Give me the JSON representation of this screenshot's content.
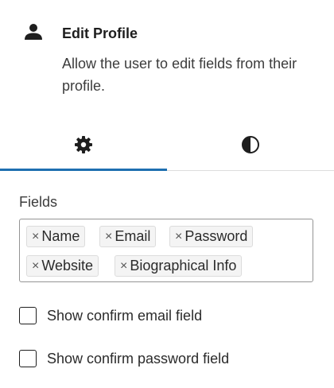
{
  "block": {
    "icon": "user-icon",
    "title": "Edit Profile",
    "description": "Allow the user to edit fields from their profile."
  },
  "tabs": [
    {
      "icon": "gear-icon",
      "active": true
    },
    {
      "icon": "half-circle-contrast-icon",
      "active": false
    }
  ],
  "fields": {
    "label": "Fields",
    "remove_glyph": "×",
    "tokens": [
      "Name",
      "Email",
      "Password",
      "Website",
      "Biographical Info"
    ]
  },
  "options": [
    {
      "label": "Show confirm email field",
      "checked": false
    },
    {
      "label": "Show confirm password field",
      "checked": false
    }
  ],
  "colors": {
    "accent": "#1e6fb0",
    "text": "#1e1e1e",
    "border": "#949494"
  }
}
